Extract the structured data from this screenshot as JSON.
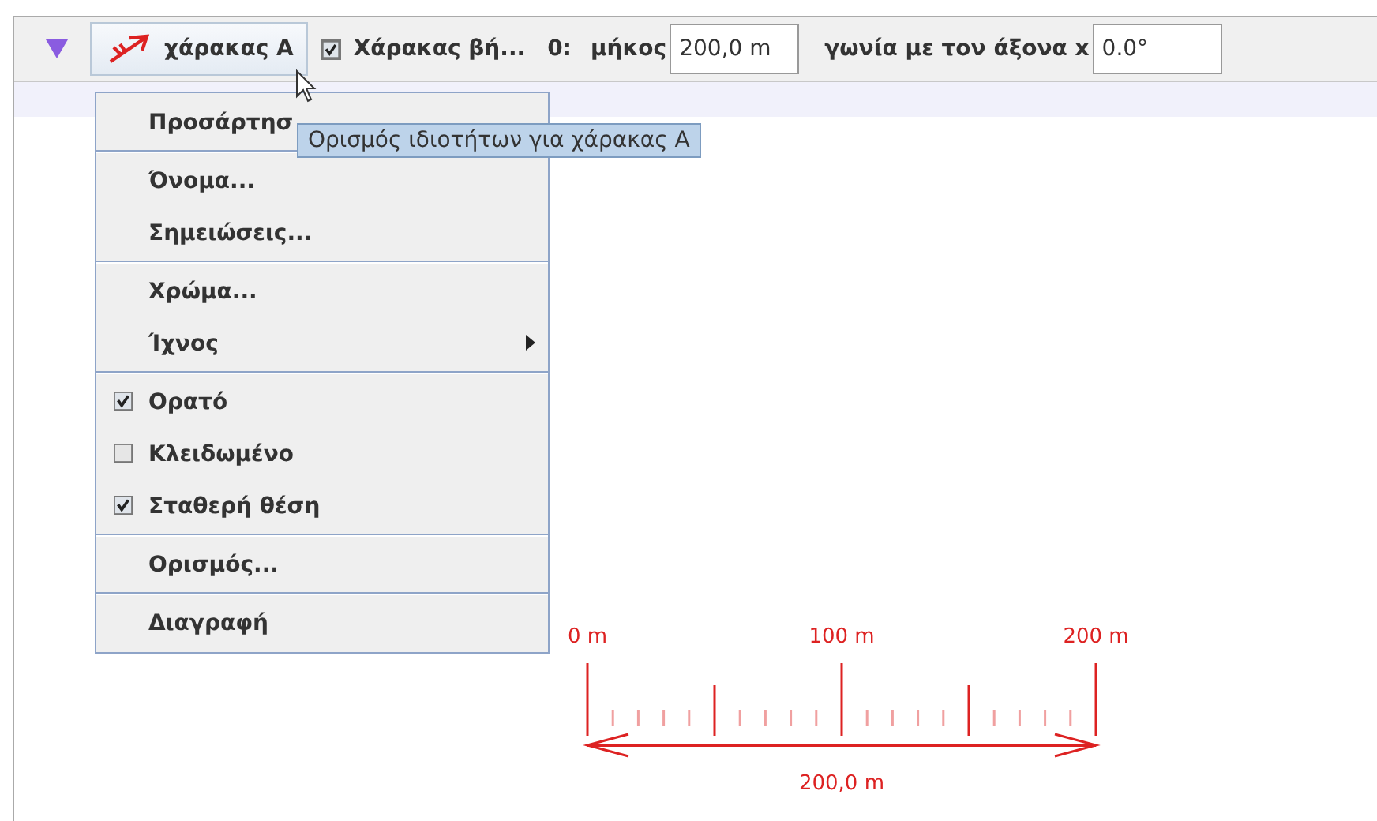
{
  "toolbar": {
    "object_button": {
      "label": "χάρακας A"
    },
    "visibility_checkbox": {
      "label": "Χάρακας βή...",
      "checked": true
    },
    "index_label": "0:",
    "length": {
      "label": "μήκος",
      "value": "200,0 m"
    },
    "angle": {
      "label": "γωνία με τον άξονα x",
      "value": "0.0°"
    }
  },
  "context_menu": {
    "items": [
      {
        "kind": "item",
        "label": "Προσάρτησ"
      },
      {
        "kind": "separator"
      },
      {
        "kind": "item",
        "label": "Όνομα..."
      },
      {
        "kind": "item",
        "label": "Σημειώσεις..."
      },
      {
        "kind": "separator"
      },
      {
        "kind": "item",
        "label": "Χρώμα..."
      },
      {
        "kind": "submenu",
        "label": "Ίχνος"
      },
      {
        "kind": "separator"
      },
      {
        "kind": "check",
        "label": "Ορατό",
        "checked": true
      },
      {
        "kind": "check",
        "label": "Κλειδωμένο",
        "checked": false
      },
      {
        "kind": "check",
        "label": "Σταθερή θέση",
        "checked": true
      },
      {
        "kind": "separator"
      },
      {
        "kind": "item",
        "label": "Ορισμός..."
      },
      {
        "kind": "separator"
      },
      {
        "kind": "item",
        "label": "Διαγραφή"
      }
    ]
  },
  "tooltip": "Ορισμός ιδιοτήτων για χάρακας A",
  "ruler": {
    "tick_labels": [
      "0 m",
      "100 m",
      "200 m"
    ],
    "measure": "200,0 m"
  }
}
